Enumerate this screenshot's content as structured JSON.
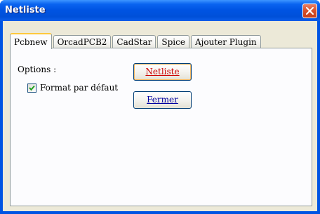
{
  "window": {
    "title": "Netliste"
  },
  "tabs": [
    {
      "label": "Pcbnew",
      "active": true
    },
    {
      "label": "OrcadPCB2",
      "active": false
    },
    {
      "label": "CadStar",
      "active": false
    },
    {
      "label": "Spice",
      "active": false
    },
    {
      "label": "Ajouter Plugin",
      "active": false
    }
  ],
  "panel": {
    "options_label": "Options :",
    "default_format": {
      "label": "Format par défaut",
      "checked": true
    },
    "netlist_button": "Netliste",
    "close_button": "Fermer"
  },
  "icons": {
    "close": "close-icon",
    "check": "checkmark-icon"
  },
  "colors": {
    "titlebar": "#0054e3",
    "client_bg": "#ece9d8",
    "panel_bg": "#fcfcfe",
    "netlist_text": "#cc0000",
    "close_text": "#0000a0",
    "close_button": "#d9522b",
    "active_tab_highlight": "#ffc83c"
  }
}
